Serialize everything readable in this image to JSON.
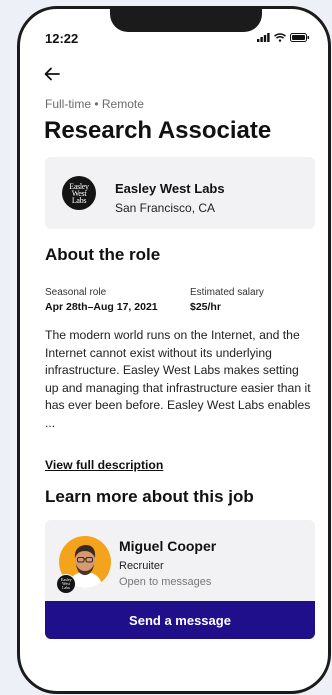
{
  "status_bar": {
    "time": "12:22",
    "icons": [
      "signal-icon",
      "wifi-icon",
      "battery-icon"
    ]
  },
  "header": {
    "back_icon": "arrow-left-icon",
    "job_meta": "Full-time • Remote",
    "job_title": "Research Associate"
  },
  "company": {
    "logo_text": "Easley West Labs",
    "name": "Easley West Labs",
    "location": "San Francisco, CA"
  },
  "about": {
    "heading": "About the role",
    "role_type_label": "Seasonal role",
    "role_dates": "Apr 28th–Aug 17, 2021",
    "salary_label": "Estimated salary",
    "salary_value": "$25/hr",
    "description": "The modern world runs on the Internet, and the Internet cannot exist without its underlying infrastructure. Easley West Labs makes setting up and managing that infrastructure easier than it has ever been before. Easley West Labs enables ...",
    "view_full_label": "View full description"
  },
  "learn_more": {
    "heading": "Learn more about this job",
    "recruiter_name": "Miguel Cooper",
    "recruiter_role": "Recruiter",
    "recruiter_status": "Open to messages",
    "badge_text": "Easley West Labs",
    "send_label": "Send a message"
  },
  "colors": {
    "accent": "#1f0f8a",
    "card_bg": "#f2f2f5",
    "avatar_bg": "#f3a41c",
    "page_bg": "#eef0f8"
  }
}
